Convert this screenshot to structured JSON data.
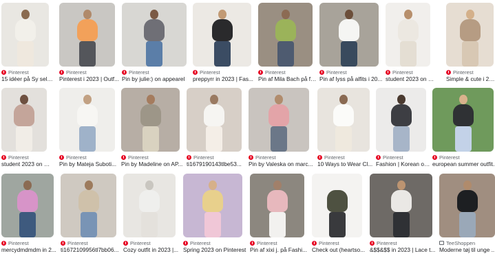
{
  "results": [
    {
      "source": "Pinterest",
      "title": "15 idéer på Sy selv i...",
      "icon": "pinterest-icon",
      "colors": {
        "bg": "#e9e7e2",
        "body": "#f2f0ea",
        "legs": "#efe8de",
        "head": "#8a6a4f"
      }
    },
    {
      "source": "Pinterest",
      "title": "Pinterest i 2023 | Outf...",
      "icon": "pinterest-icon",
      "colors": {
        "bg": "#c9c7c3",
        "body": "#f2a15a",
        "legs": "#54565b",
        "head": "#b08a6b"
      }
    },
    {
      "source": "Pinterest",
      "title": "Pin by julie:) on appearel",
      "icon": "pinterest-icon",
      "colors": {
        "bg": "#d8d7d3",
        "body": "#6f6f76",
        "legs": "#5b7ea8",
        "head": "#7b5a45"
      }
    },
    {
      "source": "Pinterest",
      "title": "preppyrr in 2023 | Fas...",
      "icon": "pinterest-icon",
      "colors": {
        "bg": "#ece9e4",
        "body": "#2a2a2c",
        "legs": "#3b4c63",
        "head": "#c29a74"
      }
    },
    {
      "source": "Pinterest",
      "title": "Pin af Mila Bach på fit...",
      "icon": "pinterest-icon",
      "colors": {
        "bg": "#9a8f82",
        "body": "#9bb35a",
        "legs": "#4e5b70",
        "head": "#8c6b53"
      }
    },
    {
      "source": "Pinterest",
      "title": "Pin af lyss på alfits i 20...",
      "icon": "pinterest-icon",
      "colors": {
        "bg": "#a8a39a",
        "body": "#f5f5f3",
        "legs": "#394a5d",
        "head": "#6b4e3a"
      }
    },
    {
      "source": "Pinterest",
      "title": "student 2023 on Pi...",
      "icon": "pinterest-icon",
      "colors": {
        "bg": "#f1efec",
        "body": "#ece8e1",
        "legs": "#e4ded3",
        "head": "#b78f6c"
      }
    },
    {
      "source": "Pinterest",
      "title": "Simple & cute i 2023",
      "icon": "pinterest-icon",
      "colors": {
        "bg": "#e6ddd2",
        "body": "#b69c83",
        "legs": "#d8c8b4",
        "head": "#d4b08a"
      }
    },
    {
      "source": "Pinterest",
      "title": "student 2023 on Pi...",
      "icon": "pinterest-icon",
      "colors": {
        "bg": "#e3e0dc",
        "body": "#c4a59a",
        "legs": "#f1ede7",
        "head": "#6e5040"
      }
    },
    {
      "source": "Pinterest",
      "title": "Pin by Mateja Suboti...",
      "icon": "pinterest-icon",
      "colors": {
        "bg": "#efeeeb",
        "body": "#f7f6f3",
        "legs": "#9fb2c9",
        "head": "#c2a183"
      }
    },
    {
      "source": "Pinterest",
      "title": "Pin by Madeline on AP...",
      "icon": "pinterest-icon",
      "colors": {
        "bg": "#b7aea5",
        "body": "#9d9688",
        "legs": "#d9d2c0",
        "head": "#a57c5e"
      }
    },
    {
      "source": "Pinterest",
      "title": "ti1679190143tlbe53...",
      "icon": "pinterest-icon",
      "colors": {
        "bg": "#d7cfc7",
        "body": "#f6f5f2",
        "legs": "#f4eee7",
        "head": "#9a7a61"
      }
    },
    {
      "source": "Pinterest",
      "title": "Pin by Valeska on marc...",
      "icon": "pinterest-icon",
      "colors": {
        "bg": "#c9c4bf",
        "body": "#e3a4a8",
        "legs": "#6b7788",
        "head": "#b18c6d"
      }
    },
    {
      "source": "Pinterest",
      "title": "10 Ways to Wear Cl...",
      "icon": "pinterest-icon",
      "colors": {
        "bg": "#e8e4de",
        "body": "#fbfbf9",
        "legs": "#efe9de",
        "head": "#8a6a52"
      }
    },
    {
      "source": "Pinterest",
      "title": "Fashion | Korean ou...",
      "icon": "pinterest-icon",
      "colors": {
        "bg": "#ecebea",
        "body": "#3d3e43",
        "legs": "#a7b5c8",
        "head": "#4a3a30"
      }
    },
    {
      "source": "Pinterest",
      "title": "european summer outfit...",
      "icon": "pinterest-icon",
      "colors": {
        "bg": "#6f9a5c",
        "body": "#2f3134",
        "legs": "#c3d2e8",
        "head": "#d9b28c"
      }
    },
    {
      "source": "Pinterest",
      "title": "mercydmdmdm in 2...",
      "icon": "pinterest-icon",
      "colors": {
        "bg": "#9fa6a0",
        "body": "#d794c8",
        "legs": "#3e5a7e",
        "head": "#8b6b53"
      }
    },
    {
      "source": "Pinterest",
      "title": "ti1672109956tl7bb06...",
      "icon": "pinterest-icon",
      "colors": {
        "bg": "#cfc9c1",
        "body": "#cfc1aa",
        "legs": "#7994b5",
        "head": "#9d7b5d"
      }
    },
    {
      "source": "Pinterest",
      "title": "Cozy outfit in 2023 |...",
      "icon": "pinterest-icon",
      "colors": {
        "bg": "#e8e6e2",
        "body": "#efefed",
        "legs": "#e4e1dc",
        "head": "#c9c6c0"
      }
    },
    {
      "source": "Pinterest",
      "title": "Spring 2023 on Pinterest",
      "icon": "pinterest-icon",
      "colors": {
        "bg": "#c7b7d3",
        "body": "#e8d08c",
        "legs": "#f0c7d7",
        "head": "#d6b08a"
      }
    },
    {
      "source": "Pinterest",
      "title": "Pin af xixi j. på Fashi...",
      "icon": "pinterest-icon",
      "colors": {
        "bg": "#8c877f",
        "body": "#e7b8bd",
        "legs": "#f2f1ef",
        "head": "#a1806a"
      }
    },
    {
      "source": "Pinterest",
      "title": "Check out (heartso...",
      "icon": "pinterest-icon",
      "colors": {
        "bg": "#f4f3f1",
        "body": "#4e5141",
        "legs": "#393a3d",
        "head": "#f4f3f1"
      }
    },
    {
      "source": "Pinterest",
      "title": "&$$&$$ in 2023 | Lace t...",
      "icon": "pinterest-icon",
      "colors": {
        "bg": "#6e6a66",
        "body": "#eae8e5",
        "legs": "#2f3135",
        "head": "#bc9471"
      }
    },
    {
      "source": "TeeShoppen",
      "title": "Moderne tøj til unge ...",
      "icon": "shop-icon",
      "colors": {
        "bg": "#a08e80",
        "body": "#1d1f22",
        "legs": "#9aa8b8",
        "head": "#b08b6c"
      }
    }
  ]
}
